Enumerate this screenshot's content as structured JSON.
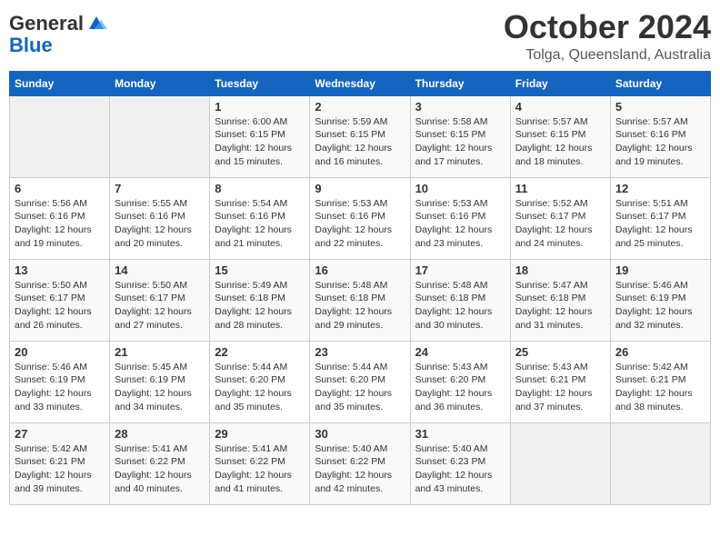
{
  "header": {
    "logo_general": "General",
    "logo_blue": "Blue",
    "month": "October 2024",
    "location": "Tolga, Queensland, Australia"
  },
  "weekdays": [
    "Sunday",
    "Monday",
    "Tuesday",
    "Wednesday",
    "Thursday",
    "Friday",
    "Saturday"
  ],
  "weeks": [
    [
      {
        "day": "",
        "info": ""
      },
      {
        "day": "",
        "info": ""
      },
      {
        "day": "1",
        "info": "Sunrise: 6:00 AM\nSunset: 6:15 PM\nDaylight: 12 hours and 15 minutes."
      },
      {
        "day": "2",
        "info": "Sunrise: 5:59 AM\nSunset: 6:15 PM\nDaylight: 12 hours and 16 minutes."
      },
      {
        "day": "3",
        "info": "Sunrise: 5:58 AM\nSunset: 6:15 PM\nDaylight: 12 hours and 17 minutes."
      },
      {
        "day": "4",
        "info": "Sunrise: 5:57 AM\nSunset: 6:15 PM\nDaylight: 12 hours and 18 minutes."
      },
      {
        "day": "5",
        "info": "Sunrise: 5:57 AM\nSunset: 6:16 PM\nDaylight: 12 hours and 19 minutes."
      }
    ],
    [
      {
        "day": "6",
        "info": "Sunrise: 5:56 AM\nSunset: 6:16 PM\nDaylight: 12 hours and 19 minutes."
      },
      {
        "day": "7",
        "info": "Sunrise: 5:55 AM\nSunset: 6:16 PM\nDaylight: 12 hours and 20 minutes."
      },
      {
        "day": "8",
        "info": "Sunrise: 5:54 AM\nSunset: 6:16 PM\nDaylight: 12 hours and 21 minutes."
      },
      {
        "day": "9",
        "info": "Sunrise: 5:53 AM\nSunset: 6:16 PM\nDaylight: 12 hours and 22 minutes."
      },
      {
        "day": "10",
        "info": "Sunrise: 5:53 AM\nSunset: 6:16 PM\nDaylight: 12 hours and 23 minutes."
      },
      {
        "day": "11",
        "info": "Sunrise: 5:52 AM\nSunset: 6:17 PM\nDaylight: 12 hours and 24 minutes."
      },
      {
        "day": "12",
        "info": "Sunrise: 5:51 AM\nSunset: 6:17 PM\nDaylight: 12 hours and 25 minutes."
      }
    ],
    [
      {
        "day": "13",
        "info": "Sunrise: 5:50 AM\nSunset: 6:17 PM\nDaylight: 12 hours and 26 minutes."
      },
      {
        "day": "14",
        "info": "Sunrise: 5:50 AM\nSunset: 6:17 PM\nDaylight: 12 hours and 27 minutes."
      },
      {
        "day": "15",
        "info": "Sunrise: 5:49 AM\nSunset: 6:18 PM\nDaylight: 12 hours and 28 minutes."
      },
      {
        "day": "16",
        "info": "Sunrise: 5:48 AM\nSunset: 6:18 PM\nDaylight: 12 hours and 29 minutes."
      },
      {
        "day": "17",
        "info": "Sunrise: 5:48 AM\nSunset: 6:18 PM\nDaylight: 12 hours and 30 minutes."
      },
      {
        "day": "18",
        "info": "Sunrise: 5:47 AM\nSunset: 6:18 PM\nDaylight: 12 hours and 31 minutes."
      },
      {
        "day": "19",
        "info": "Sunrise: 5:46 AM\nSunset: 6:19 PM\nDaylight: 12 hours and 32 minutes."
      }
    ],
    [
      {
        "day": "20",
        "info": "Sunrise: 5:46 AM\nSunset: 6:19 PM\nDaylight: 12 hours and 33 minutes."
      },
      {
        "day": "21",
        "info": "Sunrise: 5:45 AM\nSunset: 6:19 PM\nDaylight: 12 hours and 34 minutes."
      },
      {
        "day": "22",
        "info": "Sunrise: 5:44 AM\nSunset: 6:20 PM\nDaylight: 12 hours and 35 minutes."
      },
      {
        "day": "23",
        "info": "Sunrise: 5:44 AM\nSunset: 6:20 PM\nDaylight: 12 hours and 35 minutes."
      },
      {
        "day": "24",
        "info": "Sunrise: 5:43 AM\nSunset: 6:20 PM\nDaylight: 12 hours and 36 minutes."
      },
      {
        "day": "25",
        "info": "Sunrise: 5:43 AM\nSunset: 6:21 PM\nDaylight: 12 hours and 37 minutes."
      },
      {
        "day": "26",
        "info": "Sunrise: 5:42 AM\nSunset: 6:21 PM\nDaylight: 12 hours and 38 minutes."
      }
    ],
    [
      {
        "day": "27",
        "info": "Sunrise: 5:42 AM\nSunset: 6:21 PM\nDaylight: 12 hours and 39 minutes."
      },
      {
        "day": "28",
        "info": "Sunrise: 5:41 AM\nSunset: 6:22 PM\nDaylight: 12 hours and 40 minutes."
      },
      {
        "day": "29",
        "info": "Sunrise: 5:41 AM\nSunset: 6:22 PM\nDaylight: 12 hours and 41 minutes."
      },
      {
        "day": "30",
        "info": "Sunrise: 5:40 AM\nSunset: 6:22 PM\nDaylight: 12 hours and 42 minutes."
      },
      {
        "day": "31",
        "info": "Sunrise: 5:40 AM\nSunset: 6:23 PM\nDaylight: 12 hours and 43 minutes."
      },
      {
        "day": "",
        "info": ""
      },
      {
        "day": "",
        "info": ""
      }
    ]
  ]
}
